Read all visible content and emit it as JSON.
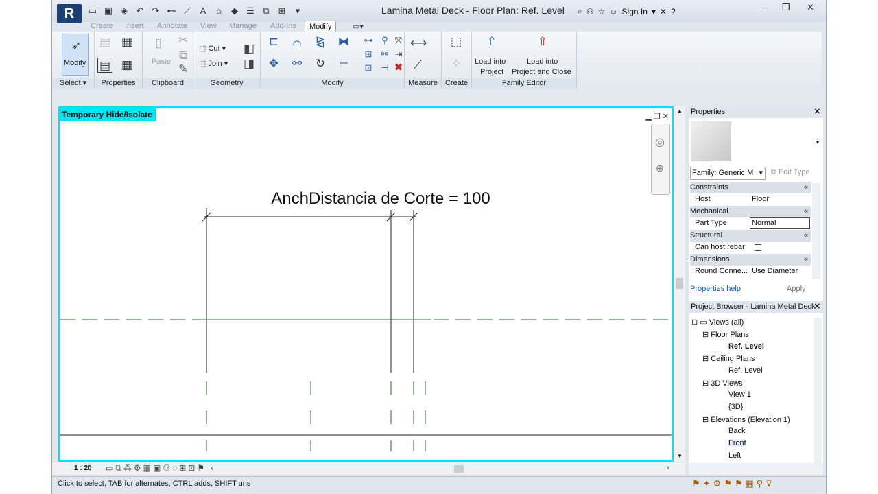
{
  "app": {
    "title": "Lamina Metal Deck - Floor Plan: Ref. Level",
    "sign_in": "Sign In",
    "logo": "R"
  },
  "tabs": [
    "Create",
    "Insert",
    "Annotate",
    "View",
    "Manage",
    "Add-Ins",
    "Modify"
  ],
  "active_tab": "Modify",
  "ribbon": {
    "select": {
      "modify": "Modify",
      "label": "Select"
    },
    "properties": {
      "label": "Properties"
    },
    "clipboard": {
      "paste": "Paste",
      "label": "Clipboard"
    },
    "geometry": {
      "cut": "Cut",
      "join": "Join",
      "label": "Geometry"
    },
    "modify": {
      "label": "Modify"
    },
    "measure": {
      "label": "Measure"
    },
    "create": {
      "label": "Create"
    },
    "family_editor": {
      "load_into_project": "Load into Project",
      "load_close_l1": "Load into",
      "load_close_l2": "Project and Close",
      "load_l1": "Load into",
      "load_l2": "Project",
      "label": "Family Editor"
    }
  },
  "view": {
    "header": "Temporary Hide/Isolate",
    "dimension_text": "AnchDistancia de Corte = 100",
    "scale": "1 : 20"
  },
  "status_text": "Click to select, TAB for alternates, CTRL adds, SHIFT uns",
  "properties": {
    "title": "Properties",
    "family": "Family: Generic M",
    "edit_type": "Edit Type",
    "rows": [
      {
        "cat": "Constraints"
      },
      {
        "name": "Host",
        "value": "Floor"
      },
      {
        "cat": "Mechanical"
      },
      {
        "name": "Part Type",
        "value": "Normal"
      },
      {
        "cat": "Structural"
      },
      {
        "name": "Can host rebar",
        "value": ""
      },
      {
        "cat": "Dimensions"
      },
      {
        "name": "Round Conne...",
        "value": "Use Diameter"
      }
    ],
    "help": "Properties help",
    "apply": "Apply"
  },
  "browser": {
    "title": "Project Browser - Lamina Metal Deck",
    "items": [
      "Views (all)",
      "Floor Plans",
      "Ref. Level",
      "Ceiling Plans",
      "Ref. Level",
      "3D Views",
      "View 1",
      "{3D}",
      "Elevations (Elevation 1)",
      "Back",
      "Front",
      "Left"
    ]
  }
}
